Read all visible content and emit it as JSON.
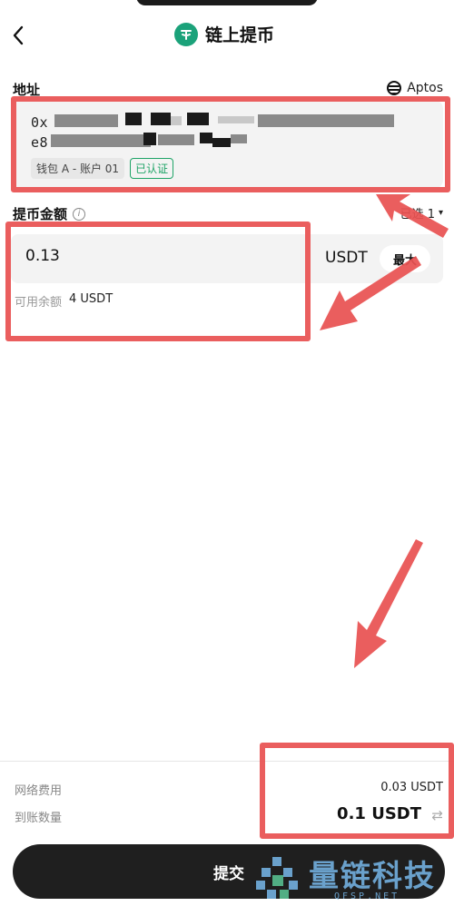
{
  "header": {
    "title": "链上提币",
    "back_icon": "chevron-left-icon",
    "token_icon": "tether-icon",
    "token_color": "#1ba27a"
  },
  "address_section": {
    "label": "地址",
    "network": "Aptos",
    "network_icon": "aptos-icon",
    "address_line1": "0x",
    "address_line2": "e8",
    "wallet_tag": "钱包 A - 账户 01",
    "verified_badge": "已认证",
    "verified_color": "#1fa467"
  },
  "amount_section": {
    "label": "提币金额",
    "info_icon": "info-icon",
    "account_select": "已选 1",
    "account_select_caret": "▾",
    "amount_value": "0.13",
    "unit": "USDT",
    "max_label": "最大",
    "balance_label": "可用余额",
    "balance_value": "4 USDT"
  },
  "summary": {
    "fee_label": "网络费用",
    "fee_value": "0.03 USDT",
    "receive_label": "到账数量",
    "receive_value": "0.1 USDT",
    "swap_icon": "swap-icon"
  },
  "submit": {
    "label": "提交"
  },
  "watermark": {
    "text": "量链科技",
    "sub": "QFSP.NET"
  },
  "annotation_color": "#e85252"
}
